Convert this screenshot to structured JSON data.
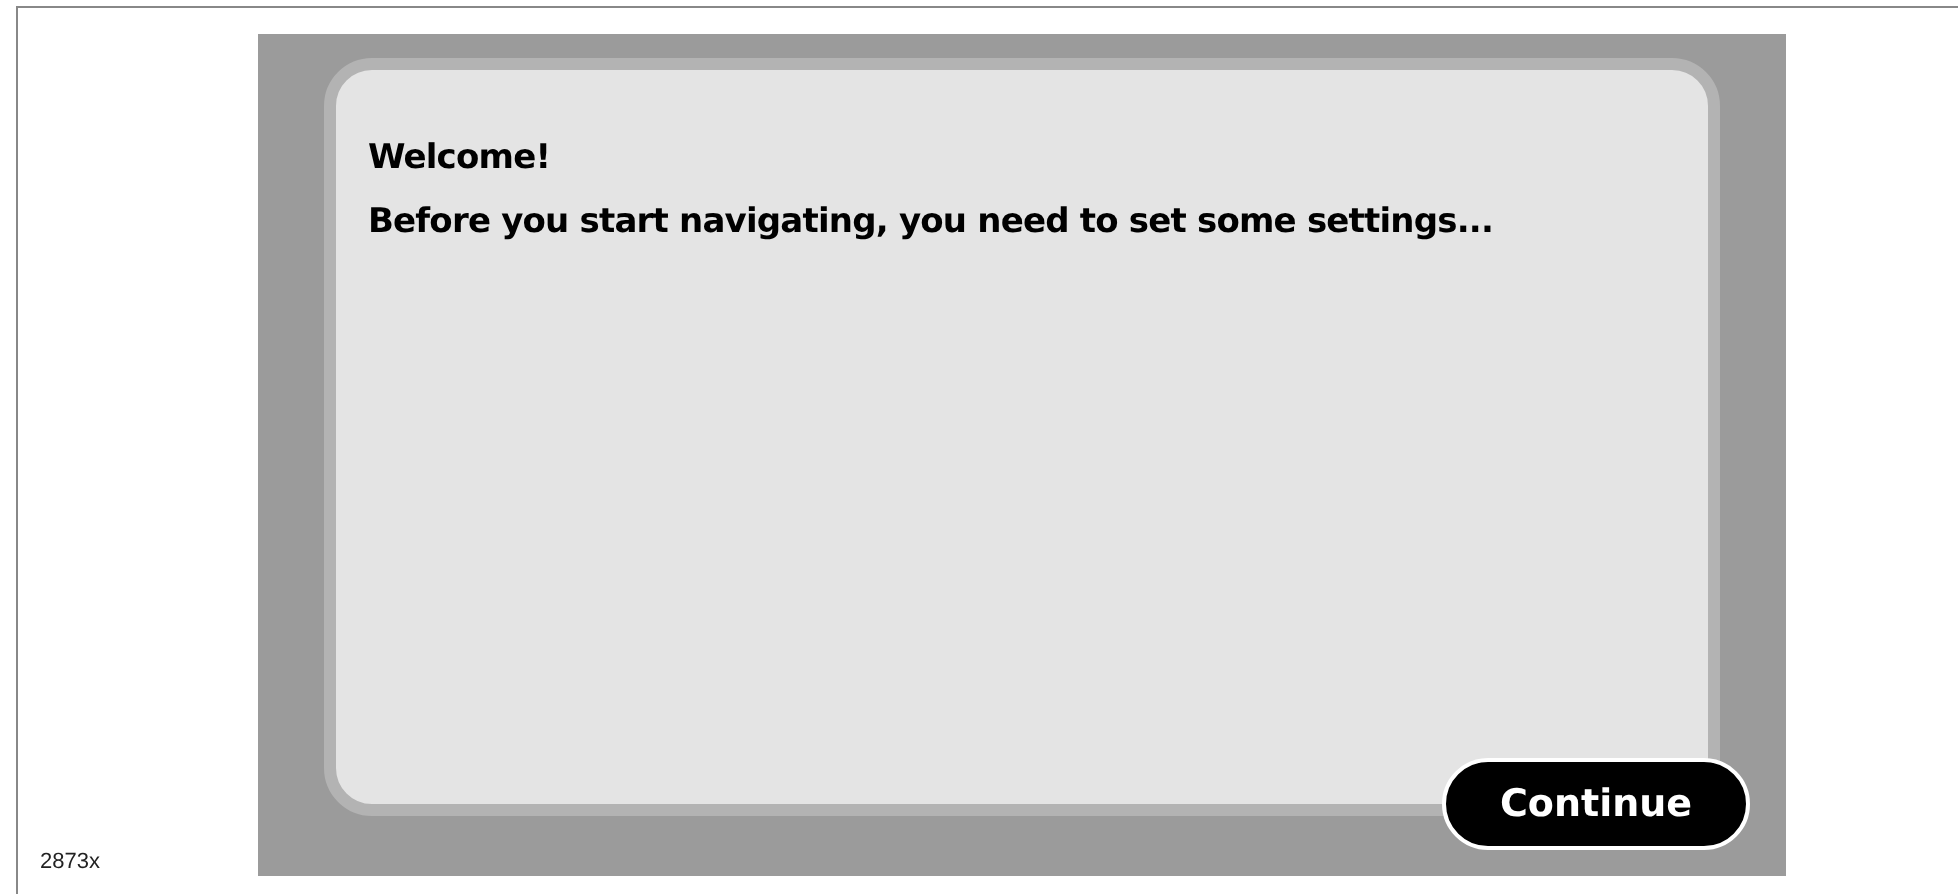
{
  "figure_label": "2873x",
  "screen": {
    "message": [
      "Welcome!",
      "Before you start navigating, you need to set some settings..."
    ],
    "button": "Continue"
  }
}
